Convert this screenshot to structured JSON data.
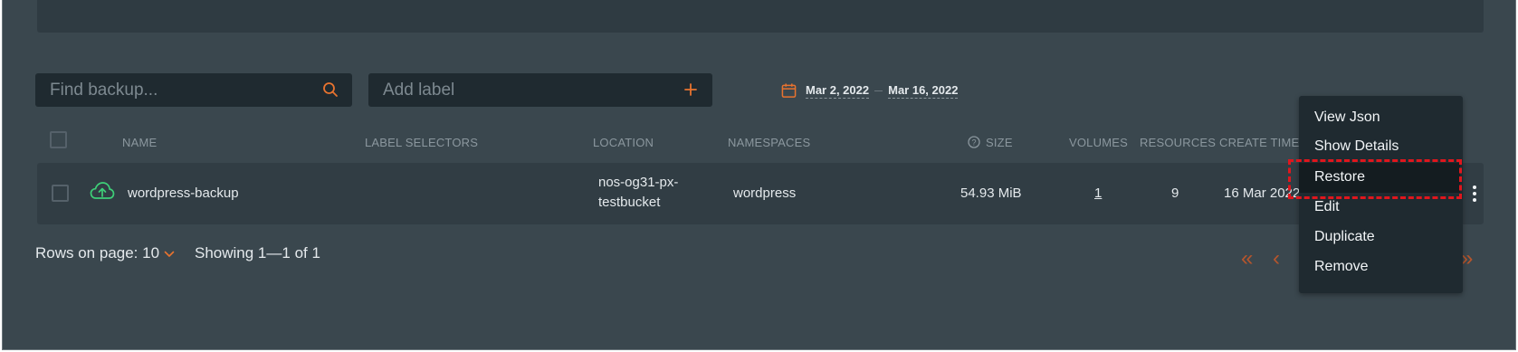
{
  "search": {
    "placeholder": "Find backup..."
  },
  "label_input": {
    "placeholder": "Add label",
    "add_symbol": "+"
  },
  "date_range": {
    "start": "Mar 2, 2022",
    "end": "Mar 16, 2022"
  },
  "table": {
    "headers": {
      "name": "NAME",
      "label_selectors": "LABEL SELECTORS",
      "location": "LOCATION",
      "namespaces": "NAMESPACES",
      "size": "SIZE",
      "volumes": "VOLUMES",
      "resources": "RESOURCES",
      "create_time": "CREATE TIME"
    },
    "rows": [
      {
        "name": "wordpress-backup",
        "location_line1": "nos-og31-px-",
        "location_line2": "testbucket",
        "namespaces": "wordpress",
        "size": "54.93 MiB",
        "volumes": "1",
        "resources": "9",
        "create_time": "16 Mar 2022"
      }
    ]
  },
  "footer": {
    "rows_label": "Rows on page:",
    "rows_value": "10",
    "showing": "Showing 1—1 of 1"
  },
  "pager": {
    "first": "«",
    "prev": "‹",
    "last": "»"
  },
  "context_menu": {
    "items": [
      "View Json",
      "Show Details",
      "Restore",
      "Edit",
      "Duplicate",
      "Remove"
    ],
    "highlighted": "Restore"
  },
  "colors": {
    "background": "#3a474e",
    "accent": "#e8732f",
    "success_icon": "#3ecf78",
    "highlight_border": "#e0161d"
  },
  "icons": {
    "search": "search-icon",
    "add": "plus-icon",
    "calendar": "calendar-icon",
    "upload": "cloud-upload-icon",
    "help": "help-circle-icon",
    "more": "more-vertical-icon"
  }
}
